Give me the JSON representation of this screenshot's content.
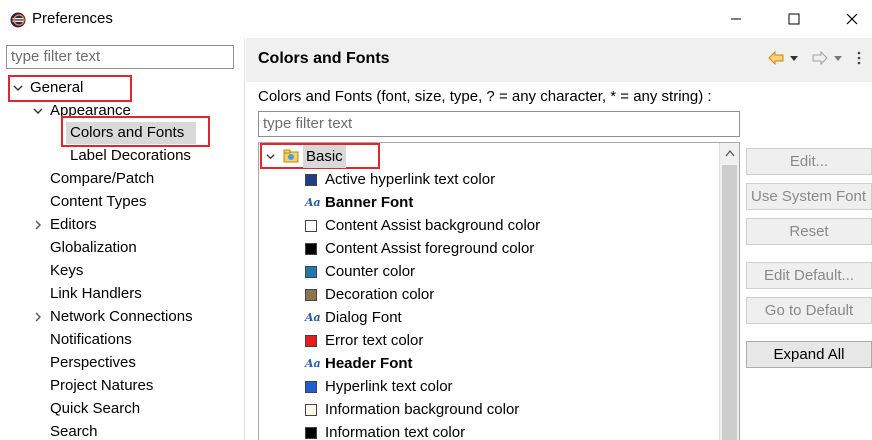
{
  "window": {
    "title": "Preferences"
  },
  "left": {
    "filter_placeholder": "type filter text",
    "tree": [
      {
        "label": "General",
        "expanded": true
      },
      {
        "label": "Appearance",
        "expanded": true
      },
      {
        "label": "Colors and Fonts",
        "selected": true
      },
      {
        "label": "Label Decorations"
      },
      {
        "label": "Compare/Patch"
      },
      {
        "label": "Content Types"
      },
      {
        "label": "Editors",
        "collapsed": true
      },
      {
        "label": "Globalization"
      },
      {
        "label": "Keys"
      },
      {
        "label": "Link Handlers"
      },
      {
        "label": "Network Connections",
        "collapsed": true
      },
      {
        "label": "Notifications"
      },
      {
        "label": "Perspectives"
      },
      {
        "label": "Project Natures"
      },
      {
        "label": "Quick Search"
      },
      {
        "label": "Search"
      }
    ]
  },
  "page": {
    "title": "Colors and Fonts",
    "description": "Colors and Fonts (font, size, type, ? = any character, * = any string) :",
    "filter_placeholder": "type filter text",
    "category": "Basic",
    "items": [
      {
        "label": "Active hyperlink text color",
        "kind": "color",
        "color": "#1f3f85"
      },
      {
        "label": "Banner Font",
        "kind": "font",
        "bold": true
      },
      {
        "label": "Content Assist background color",
        "kind": "color",
        "color": "#ffffff"
      },
      {
        "label": "Content Assist foreground color",
        "kind": "color",
        "color": "#000000"
      },
      {
        "label": "Counter color",
        "kind": "color",
        "color": "#1e7aa8"
      },
      {
        "label": "Decoration color",
        "kind": "color",
        "color": "#8a7550"
      },
      {
        "label": "Dialog Font",
        "kind": "font"
      },
      {
        "label": "Error text color",
        "kind": "color",
        "color": "#e61e1e"
      },
      {
        "label": "Header Font",
        "kind": "font",
        "bold": true
      },
      {
        "label": "Hyperlink text color",
        "kind": "color",
        "color": "#1e5ed2"
      },
      {
        "label": "Information background color",
        "kind": "color",
        "color": "#fbfbe6"
      },
      {
        "label": "Information text color",
        "kind": "color",
        "color": "#000000"
      }
    ],
    "buttons": {
      "edit": "Edit...",
      "use_system_font": "Use System Font",
      "reset": "Reset",
      "edit_default": "Edit Default...",
      "go_to_default": "Go to Default",
      "expand_all": "Expand All"
    }
  },
  "icons": {
    "font_glyph": "Aa",
    "back": "back-arrow-icon",
    "forward": "forward-arrow-icon",
    "menu": "view-menu-icon"
  },
  "colors": {
    "highlight": "#e0262f",
    "selection": "#d9d9d9",
    "accent": "#e8a200"
  }
}
